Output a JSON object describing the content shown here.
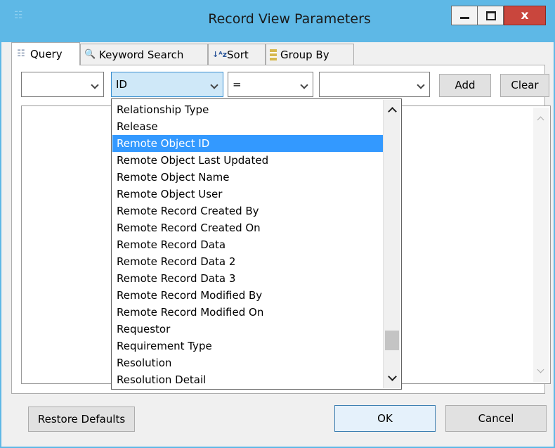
{
  "window": {
    "title": "Record View Parameters",
    "close_label": "x"
  },
  "tabs": [
    {
      "label": "Query",
      "icon": "query-icon",
      "active": true
    },
    {
      "label": "Keyword Search",
      "icon": "keyword-search-icon",
      "active": false
    },
    {
      "label": "Sort",
      "icon": "sort-az-icon",
      "active": false
    },
    {
      "label": "Group By",
      "icon": "group-by-icon",
      "active": false
    }
  ],
  "criteria": {
    "logic_value": "",
    "field_value": "ID",
    "operator_value": "=",
    "value_value": "",
    "add_label": "Add",
    "clear_label": "Clear"
  },
  "field_dropdown": {
    "options": [
      "Relationship Type",
      "Release",
      "Remote Object ID",
      "Remote Object Last Updated",
      "Remote Object Name",
      "Remote Object User",
      "Remote Record Created By",
      "Remote Record Created On",
      "Remote Record Data",
      "Remote Record Data 2",
      "Remote Record Data 3",
      "Remote Record Modified By",
      "Remote Record Modified On",
      "Requestor",
      "Requirement Type",
      "Resolution",
      "Resolution Detail"
    ],
    "highlighted": "Remote Object ID"
  },
  "footer": {
    "restore_label": "Restore Defaults",
    "ok_label": "OK",
    "cancel_label": "Cancel"
  },
  "colors": {
    "titlebar": "#5eb8e6",
    "selection": "#3399ff",
    "close_button": "#c9463d"
  }
}
